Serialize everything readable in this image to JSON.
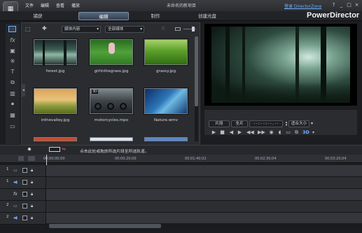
{
  "titlebar": {
    "menus": [
      "文件",
      "编辑",
      "查看",
      "播放"
    ],
    "project": "未命名的新项目",
    "director_zone": "登录 DirectorZone",
    "brand": "PowerDirector",
    "window_buttons": [
      "?",
      "_",
      "□",
      "×"
    ]
  },
  "modes": {
    "capture": "捕获",
    "edit": "编辑",
    "produce": "制作",
    "disc": "创建光盘"
  },
  "library": {
    "filter1": "媒体内容",
    "filter2": "全部媒体",
    "items": [
      {
        "name": "forest.jpg"
      },
      {
        "name": "girlinthegrass.jpg"
      },
      {
        "name": "grassy.jpg"
      },
      {
        "name": "inthevalley.jpg"
      },
      {
        "name": "motorcycles.mpo",
        "badge": "3D"
      },
      {
        "name": "Nature.wmv"
      }
    ]
  },
  "preview": {
    "clip_btn": "片段",
    "movie_btn": "全片",
    "timecode": "--:--:--.--",
    "fit": "适合大小",
    "three_d": "3D"
  },
  "timeline": {
    "hint": "点击此处或拖放所选片段至所选轨道。",
    "ruler": [
      "00;00;00;00",
      "00;00;20;00",
      "00;01;40;02",
      "00;02;30;04",
      "00;03;20;04"
    ],
    "tracks": [
      {
        "num": "1",
        "icon": "video-track-icon"
      },
      {
        "num": "1",
        "icon": "audio-track-icon"
      },
      {
        "num": "",
        "icon": "fx-track-icon"
      },
      {
        "num": "2",
        "icon": "video-track-icon"
      },
      {
        "num": "2",
        "icon": "audio-track-icon"
      }
    ]
  },
  "colors": {
    "accent": "#6fb3ff",
    "active_tab": "#4a5d73",
    "background": "#1c1d20"
  }
}
